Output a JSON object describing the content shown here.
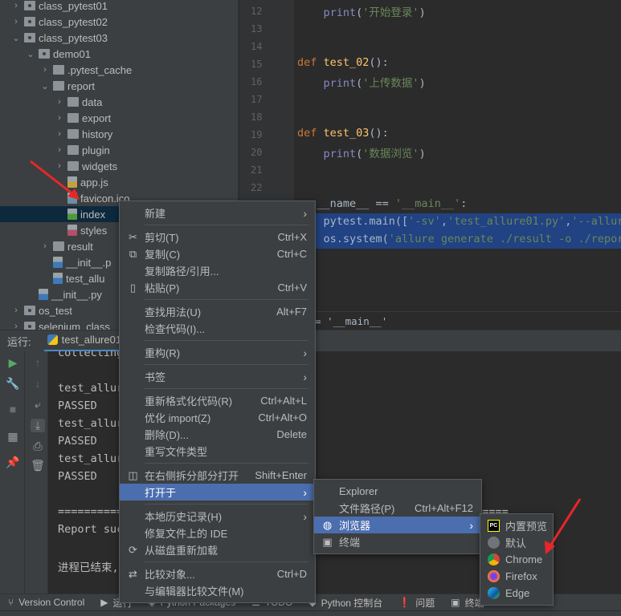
{
  "project_tree": [
    {
      "label": "class_pytest01",
      "depth": 1,
      "arrow": "right",
      "icon": "module"
    },
    {
      "label": "class_pytest02",
      "depth": 1,
      "arrow": "right",
      "icon": "module"
    },
    {
      "label": "class_pytest03",
      "depth": 1,
      "arrow": "down",
      "icon": "module"
    },
    {
      "label": "demo01",
      "depth": 2,
      "arrow": "down",
      "icon": "module"
    },
    {
      "label": ".pytest_cache",
      "depth": 3,
      "arrow": "right",
      "icon": "folder"
    },
    {
      "label": "report",
      "depth": 3,
      "arrow": "down",
      "icon": "folder"
    },
    {
      "label": "data",
      "depth": 4,
      "arrow": "right",
      "icon": "folder"
    },
    {
      "label": "export",
      "depth": 4,
      "arrow": "right",
      "icon": "folder"
    },
    {
      "label": "history",
      "depth": 4,
      "arrow": "right",
      "icon": "folder"
    },
    {
      "label": "plugin",
      "depth": 4,
      "arrow": "right",
      "icon": "folder"
    },
    {
      "label": "widgets",
      "depth": 4,
      "arrow": "right",
      "icon": "folder"
    },
    {
      "label": "app.js",
      "depth": 4,
      "arrow": "",
      "icon": "js"
    },
    {
      "label": "favicon.ico",
      "depth": 4,
      "arrow": "",
      "icon": "image"
    },
    {
      "label": "index",
      "depth": 4,
      "arrow": "",
      "icon": "html",
      "selected": true
    },
    {
      "label": "styles",
      "depth": 4,
      "arrow": "",
      "icon": "css"
    },
    {
      "label": "result",
      "depth": 3,
      "arrow": "right",
      "icon": "folder"
    },
    {
      "label": "__init__.p",
      "depth": 3,
      "arrow": "",
      "icon": "python"
    },
    {
      "label": "test_allu",
      "depth": 3,
      "arrow": "",
      "icon": "python"
    },
    {
      "label": "__init__.py",
      "depth": 2,
      "arrow": "",
      "icon": "python"
    },
    {
      "label": "os_test",
      "depth": 1,
      "arrow": "right",
      "icon": "module"
    },
    {
      "label": "selenium_class",
      "depth": 1,
      "arrow": "right",
      "icon": "module"
    }
  ],
  "editor": {
    "lines": [
      {
        "n": "12",
        "tokens": [
          [
            "    ",
            ""
          ],
          [
            "print",
            "builtin"
          ],
          [
            "(",
            ""
          ],
          [
            "'开始登录'",
            "str"
          ],
          [
            ")",
            ""
          ]
        ]
      },
      {
        "n": "13",
        "tokens": []
      },
      {
        "n": "14",
        "tokens": []
      },
      {
        "n": "15",
        "tokens": [
          [
            "def ",
            "kw"
          ],
          [
            "test_02",
            "fn"
          ],
          [
            "():",
            ""
          ]
        ]
      },
      {
        "n": "16",
        "tokens": [
          [
            "    ",
            ""
          ],
          [
            "print",
            "builtin"
          ],
          [
            "(",
            ""
          ],
          [
            "'上传数据'",
            "str"
          ],
          [
            ")",
            ""
          ]
        ]
      },
      {
        "n": "17",
        "tokens": []
      },
      {
        "n": "18",
        "tokens": []
      },
      {
        "n": "19",
        "tokens": [
          [
            "def ",
            "kw"
          ],
          [
            "test_03",
            "fn"
          ],
          [
            "():",
            ""
          ]
        ]
      },
      {
        "n": "20",
        "tokens": [
          [
            "    ",
            ""
          ],
          [
            "print",
            "builtin"
          ],
          [
            "(",
            ""
          ],
          [
            "'数据浏览'",
            "str"
          ],
          [
            ")",
            ""
          ]
        ]
      },
      {
        "n": "21",
        "tokens": []
      },
      {
        "n": "22",
        "tokens": []
      },
      {
        "n": "",
        "tokens": [
          [
            "   __name__ == ",
            ""
          ],
          [
            "'__main__'",
            "str"
          ],
          [
            ":",
            ""
          ]
        ]
      },
      {
        "n": "",
        "tokens": [
          [
            "    pytest.main([",
            ""
          ],
          [
            "'-sv'",
            "str"
          ],
          [
            ",",
            ""
          ],
          [
            "'test_allure01.py'",
            "str"
          ],
          [
            ",",
            ""
          ],
          [
            "'--allure",
            "str"
          ]
        ],
        "selected": true
      },
      {
        "n": "",
        "tokens": [
          [
            "    os.system(",
            ""
          ],
          [
            "'allure generate ./result -o ./report",
            "str"
          ]
        ],
        "selected": true
      }
    ],
    "breadcrumb": "= '__main__'",
    "colors": {
      "kw": "#cc7832",
      "fn": "#ffc66d",
      "builtin": "#8888c6",
      "str": "#6a8759",
      "selection": "#214283"
    }
  },
  "run_panel": {
    "label": "运行:",
    "tab": "test_allure01",
    "console": [
      "collecting",
      "",
      "test_allur",
      "PASSED",
      "test_allur",
      "PASSED",
      "test_allur",
      "PASSED",
      "",
      "=====================================================================",
      "Report suc",
      "",
      "进程已结束,"
    ]
  },
  "bottom_bar": [
    "Version Control",
    "运行",
    "Python Packages",
    "TODO",
    "Python 控制台",
    "问题",
    "终端"
  ],
  "context_menu": [
    {
      "label": "新建",
      "submenu": true
    },
    {
      "sep": true
    },
    {
      "label": "剪切(T)",
      "shortcut": "Ctrl+X",
      "icon": "scissors-icon",
      "glyph": "✂"
    },
    {
      "label": "复制(C)",
      "shortcut": "Ctrl+C",
      "icon": "copy-icon",
      "glyph": "⧉"
    },
    {
      "label": "复制路径/引用..."
    },
    {
      "label": "粘贴(P)",
      "shortcut": "Ctrl+V",
      "icon": "clipboard-icon",
      "glyph": "▯"
    },
    {
      "sep": true
    },
    {
      "label": "查找用法(U)",
      "shortcut": "Alt+F7"
    },
    {
      "label": "检查代码(I)..."
    },
    {
      "sep": true
    },
    {
      "label": "重构(R)",
      "submenu": true
    },
    {
      "sep": true
    },
    {
      "label": "书签",
      "submenu": true
    },
    {
      "sep": true
    },
    {
      "label": "重新格式化代码(R)",
      "shortcut": "Ctrl+Alt+L"
    },
    {
      "label": "优化 import(Z)",
      "shortcut": "Ctrl+Alt+O"
    },
    {
      "label": "删除(D)...",
      "shortcut": "Delete"
    },
    {
      "label": "重写文件类型"
    },
    {
      "sep": true
    },
    {
      "label": "在右侧拆分部分打开",
      "shortcut": "Shift+Enter",
      "icon": "split-icon",
      "glyph": "◫"
    },
    {
      "label": "打开于",
      "submenu": true,
      "active": true
    },
    {
      "sep": true
    },
    {
      "label": "本地历史记录(H)",
      "submenu": true
    },
    {
      "label": "修复文件上的 IDE"
    },
    {
      "label": "从磁盘重新加载",
      "icon": "reload-icon",
      "glyph": "⟳"
    },
    {
      "sep": true
    },
    {
      "label": "比较对象...",
      "shortcut": "Ctrl+D",
      "icon": "compare-icon",
      "glyph": "⇄"
    },
    {
      "label": "与编辑器比较文件(M)"
    }
  ],
  "open_in_menu": [
    {
      "label": "Explorer"
    },
    {
      "label": "文件路径(P)",
      "shortcut": "Ctrl+Alt+F12"
    },
    {
      "label": "浏览器",
      "submenu": true,
      "active": true,
      "icon": "globe-icon",
      "glyph": "◍"
    },
    {
      "label": "终端",
      "icon": "terminal-icon",
      "glyph": "▣"
    }
  ],
  "browser_menu": [
    {
      "label": "内置预览",
      "icon": "pycharm-icon"
    },
    {
      "label": "默认",
      "icon": "globe-icon"
    },
    {
      "label": "Chrome",
      "icon": "chrome-icon"
    },
    {
      "label": "Firefox",
      "icon": "firefox-icon"
    },
    {
      "label": "Edge",
      "icon": "edge-icon"
    }
  ],
  "accent": "#4b6eaf",
  "annotation_color": "#e8262a"
}
